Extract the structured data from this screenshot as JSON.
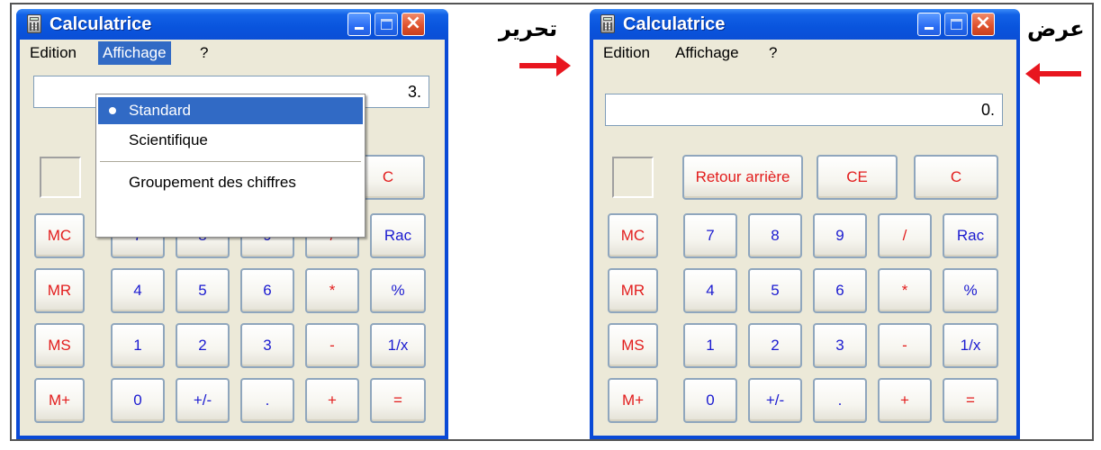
{
  "left_window": {
    "title": "Calculatrice",
    "menu": [
      "Edition",
      "Affichage",
      "?"
    ],
    "display_value": "3.",
    "dropdown": {
      "items": [
        "Standard",
        "Scientifique",
        "Groupement des chiffres"
      ],
      "selected": "Standard"
    },
    "top_keys": [
      "C"
    ],
    "memory_keys": [
      "MC",
      "MR",
      "MS",
      "M+"
    ],
    "keypad": [
      [
        "7",
        "8",
        "9",
        "/",
        "Rac"
      ],
      [
        "4",
        "5",
        "6",
        "*",
        "%"
      ],
      [
        "1",
        "2",
        "3",
        "-",
        "1/x"
      ],
      [
        "0",
        "+/-",
        ".",
        "+",
        "="
      ]
    ]
  },
  "right_window": {
    "title": "Calculatrice",
    "menu": [
      "Edition",
      "Affichage",
      "?"
    ],
    "display_value": "0.",
    "top_keys": [
      "Retour arrière",
      "CE",
      "C"
    ],
    "memory_keys": [
      "MC",
      "MR",
      "MS",
      "M+"
    ],
    "keypad": [
      [
        "7",
        "8",
        "9",
        "/",
        "Rac"
      ],
      [
        "4",
        "5",
        "6",
        "*",
        "%"
      ],
      [
        "1",
        "2",
        "3",
        "-",
        "1/x"
      ],
      [
        "0",
        "+/-",
        ".",
        "+",
        "="
      ]
    ]
  },
  "annotations": {
    "edit_label": "تحرير",
    "view_label": "عرض"
  },
  "colors": {
    "arrow": "#e8161f",
    "titlebar": "#0954dd",
    "menu_highlight": "#316ac5",
    "operator_key_text": "#e21c1c",
    "digit_key_text": "#1b1bd0"
  }
}
